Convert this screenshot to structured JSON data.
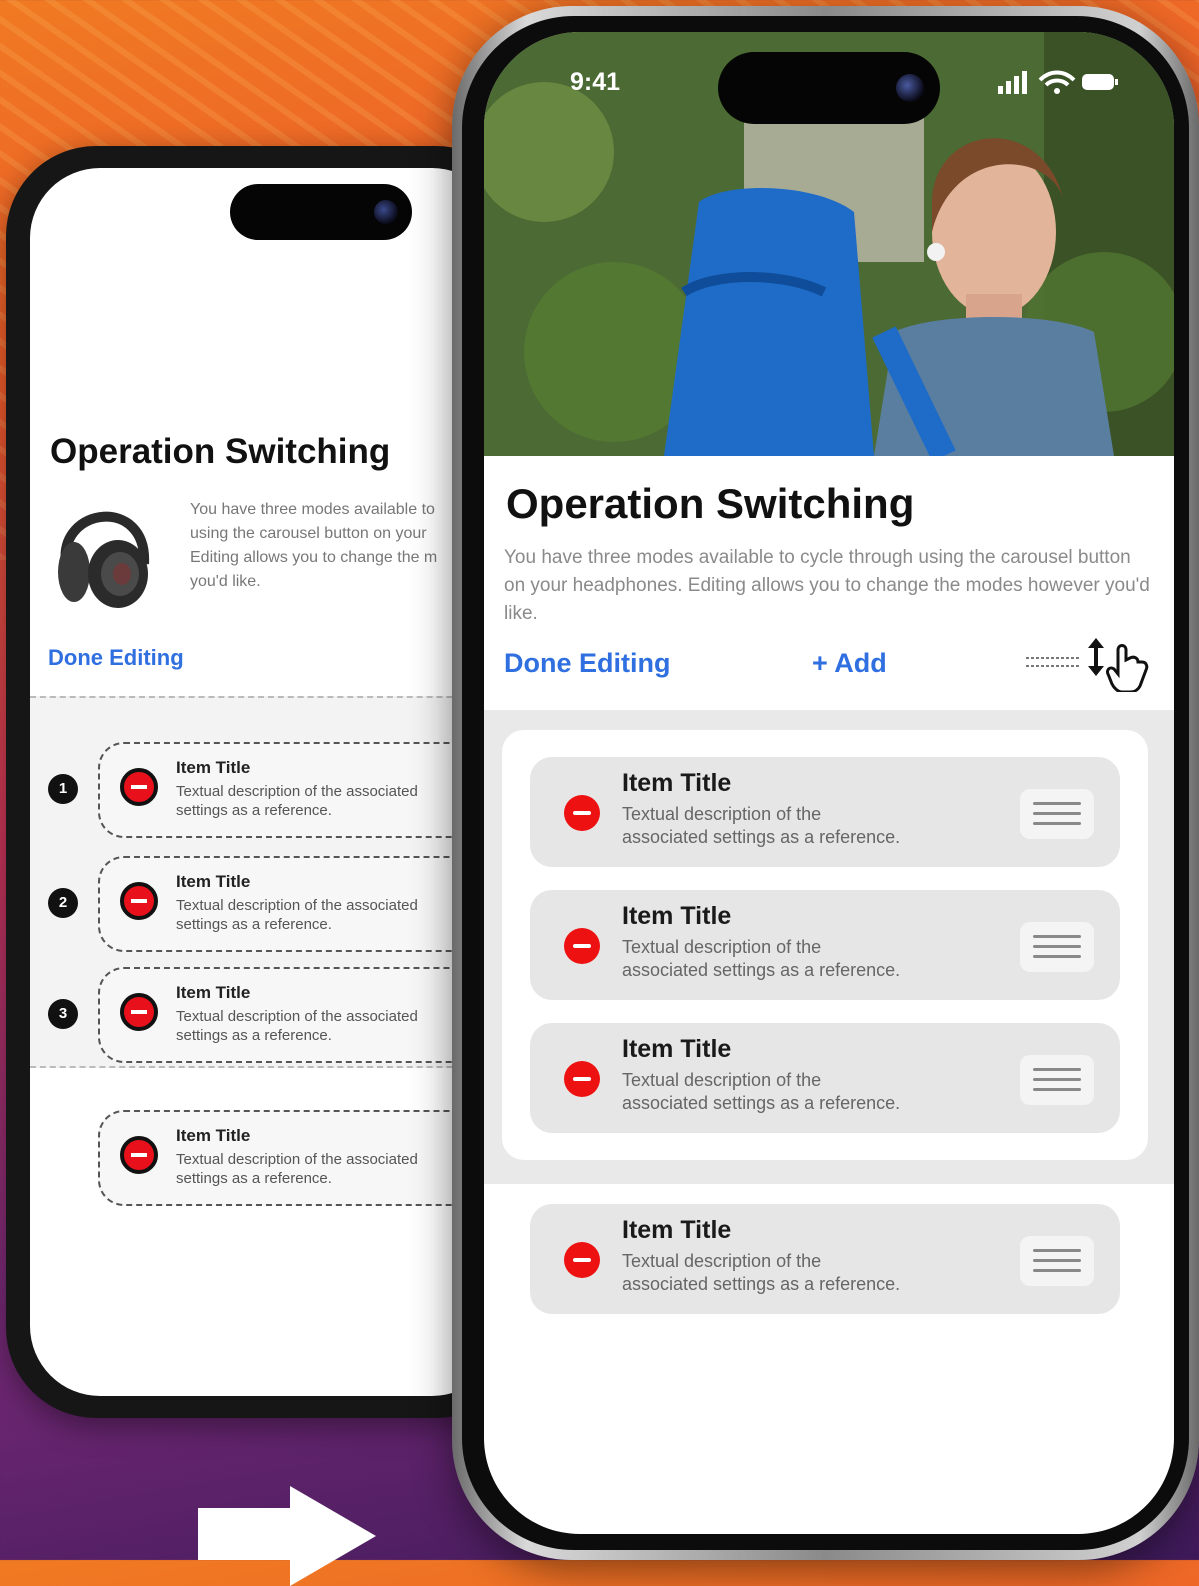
{
  "back_phone": {
    "title": "Operation Switching",
    "description_lines": [
      "You have three modes available to",
      "using the carousel button on your",
      "Editing allows you to change the m",
      "you'd like."
    ],
    "done_label": "Done Editing",
    "items": [
      {
        "step": "1",
        "title": "Item Title",
        "desc1": "Textual description of the associated",
        "desc2": "settings as a reference."
      },
      {
        "step": "2",
        "title": "Item Title",
        "desc1": "Textual description of the associated",
        "desc2": "settings as a reference."
      },
      {
        "step": "3",
        "title": "Item Title",
        "desc1": "Textual description of the associated",
        "desc2": "settings as a reference."
      },
      {
        "step": "",
        "title": "Item Title",
        "desc1": "Textual description of the associated",
        "desc2": "settings as a reference."
      }
    ]
  },
  "front_phone": {
    "status": {
      "time": "9:41"
    },
    "title": "Operation Switching",
    "description": "You have three modes available to cycle through using the carousel button on your headphones. Editing allows you to change the modes however you'd like.",
    "done_label": "Done Editing",
    "add_label": "+ Add",
    "items": [
      {
        "title": "Item Title",
        "desc1": "Textual description of the",
        "desc2": "associated settings as a reference."
      },
      {
        "title": "Item Title",
        "desc1": "Textual description of the",
        "desc2": "associated settings as a reference."
      },
      {
        "title": "Item Title",
        "desc1": "Textual description of the",
        "desc2": "associated settings as a reference."
      },
      {
        "title": "Item Title",
        "desc1": "Textual description of the",
        "desc2": "associated settings as a reference."
      }
    ]
  },
  "colors": {
    "accent_blue": "#2f6fe0",
    "delete_red": "#ee1111"
  },
  "icons": [
    "minus-circle-icon",
    "drag-handle-icon",
    "reorder-hand-icon",
    "signal-icon",
    "wifi-icon",
    "battery-icon",
    "right-arrow-icon"
  ]
}
